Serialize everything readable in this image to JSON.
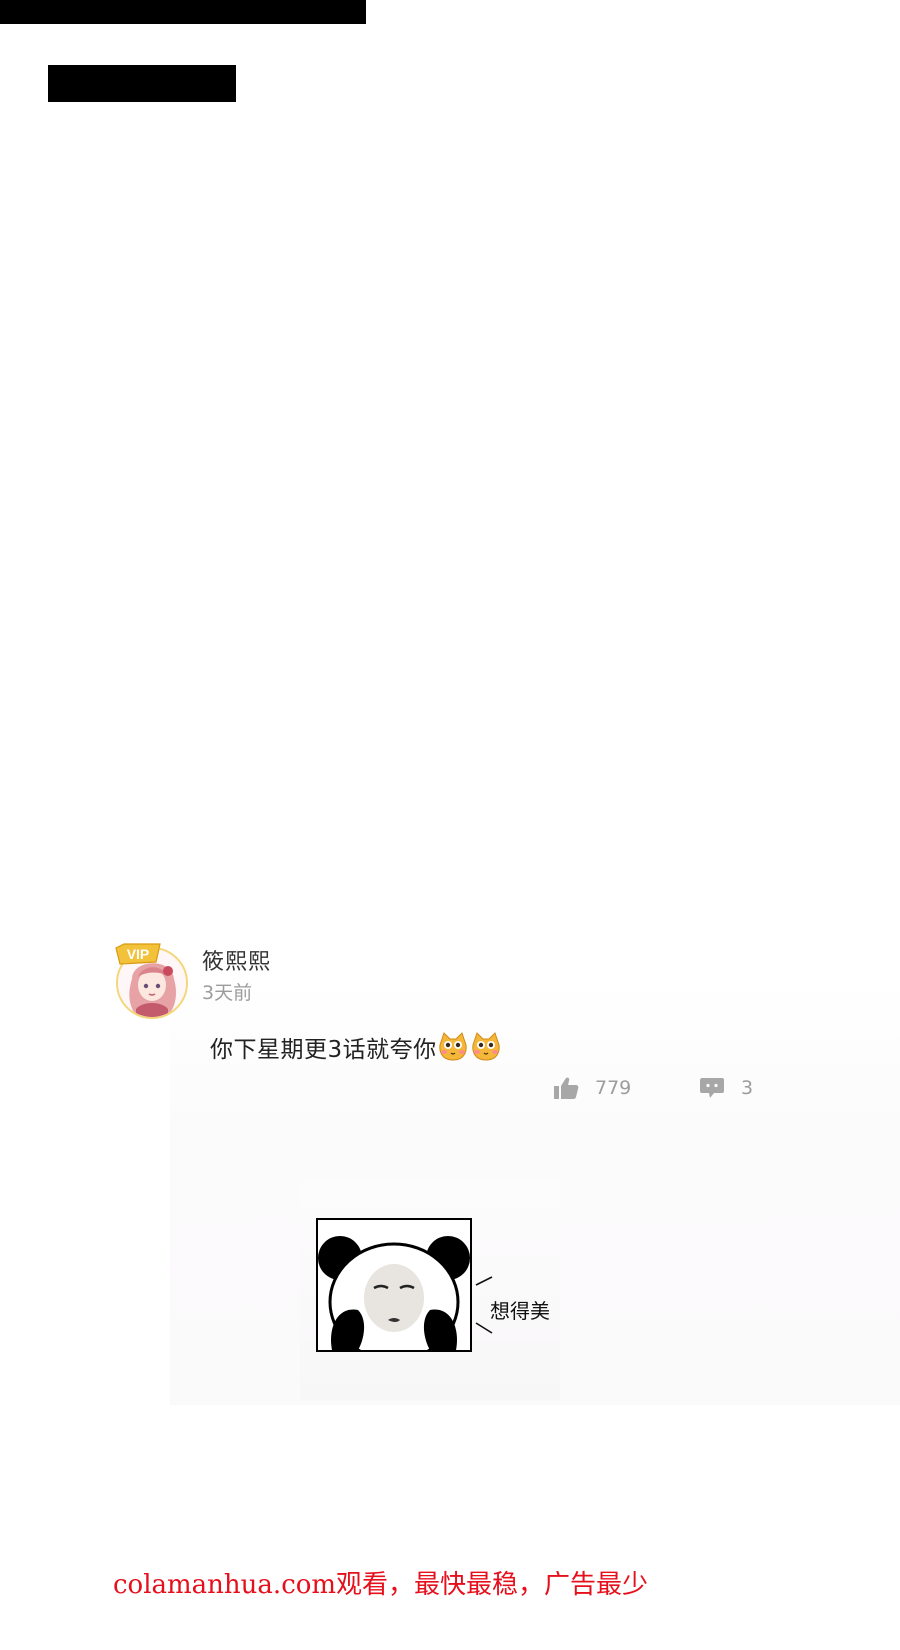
{
  "comment": {
    "username": "筱熙熙",
    "timestamp": "3天前",
    "text": "你下星期更3话就夸你",
    "badge": "VIP",
    "emojis": [
      "blushing-cat-emoji",
      "blushing-cat-emoji"
    ],
    "likes": "779",
    "replies": "3"
  },
  "meme": {
    "caption": "想得美",
    "icon": "panda-face-meme"
  },
  "footer": {
    "notice": "colamanhua.com观看，最快最稳，广告最少"
  },
  "colors": {
    "footer_red": "#e60f1c",
    "icon_gray": "#a7a7a7",
    "vip_gold": "#f2c23a"
  }
}
